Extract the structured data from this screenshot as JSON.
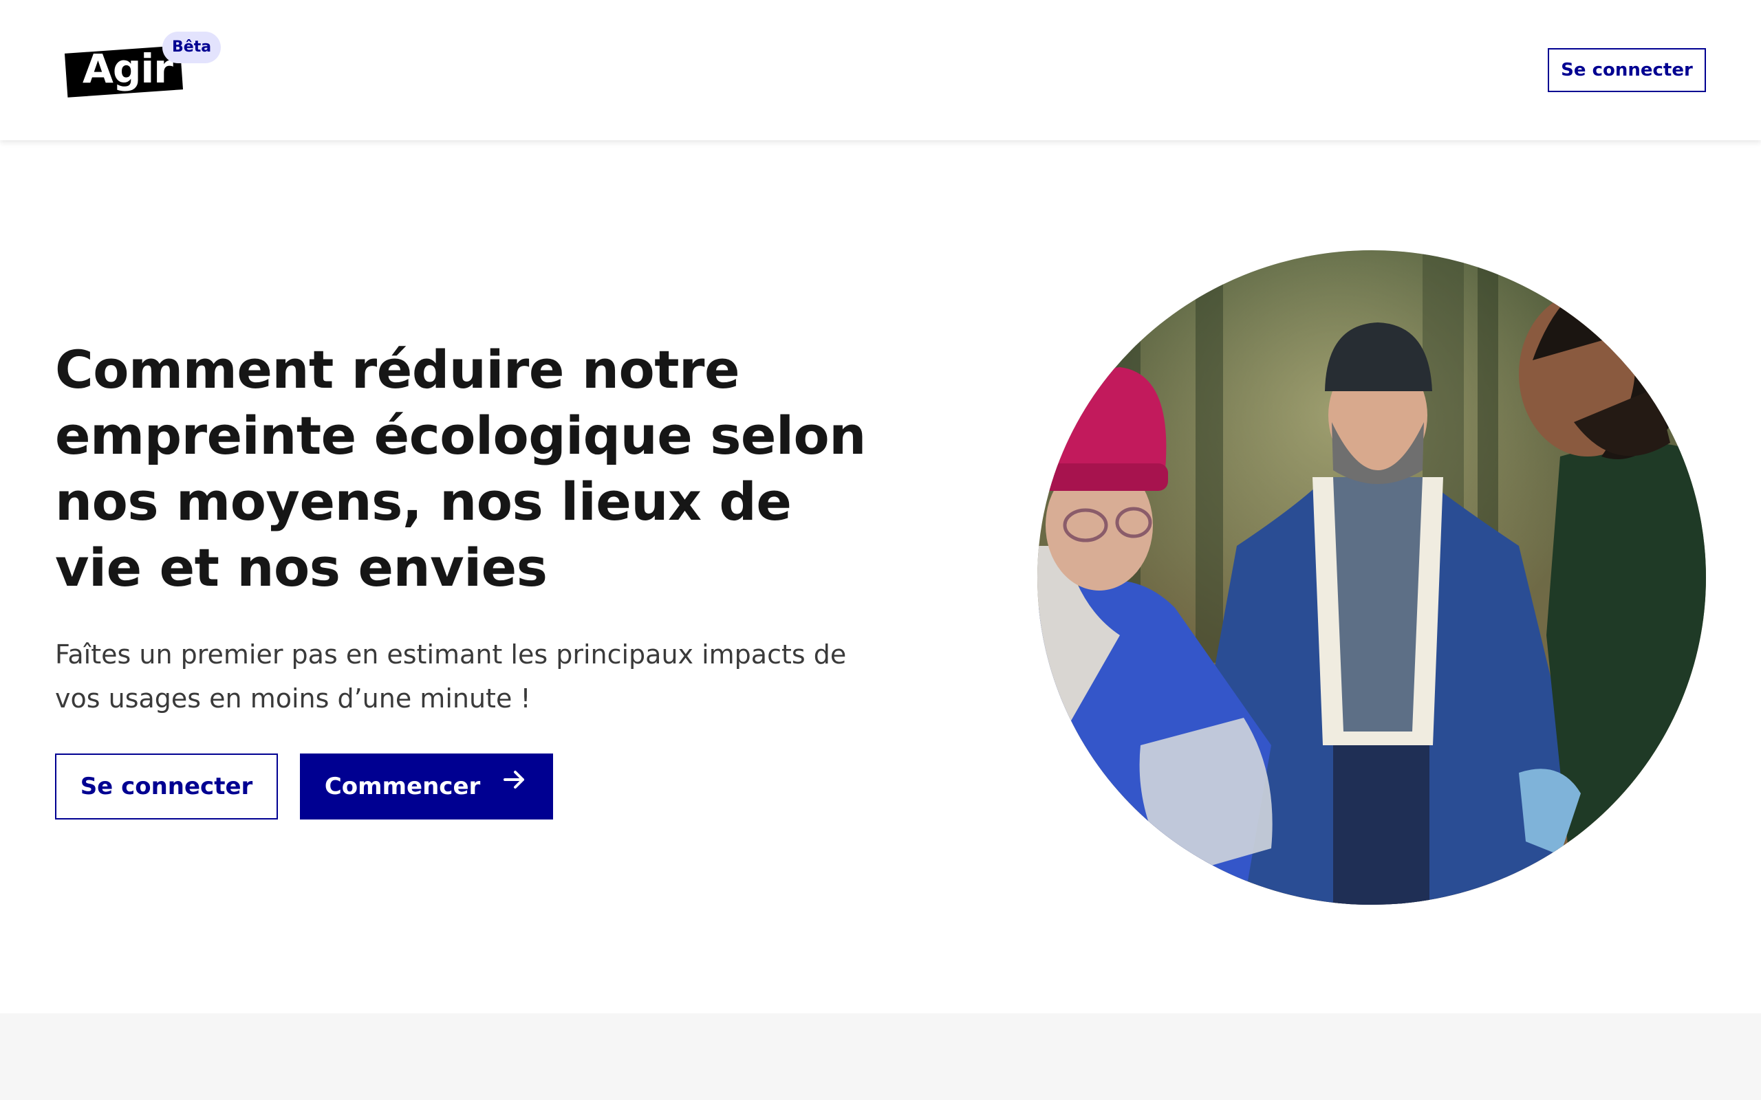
{
  "header": {
    "logo_text": "Agir",
    "beta_label": "Bêta",
    "login_label": "Se connecter"
  },
  "hero": {
    "title": "Comment réduire notre empreinte écologique selon nos moyens, nos lieux de vie et nos envies",
    "subtitle": "Faîtes un premier pas en estimant les principaux impacts de vos usages en moins d’une minute !",
    "secondary_button_label": "Se connecter",
    "primary_button_label": "Commencer",
    "primary_button_icon": "arrow-right-icon",
    "photo_icon": "people-in-forest-photo"
  },
  "colors": {
    "brand_blue": "#000091",
    "beta_badge_bg": "#e3e3fd",
    "text_dark": "#161616",
    "bottom_band": "#f6f6f6"
  }
}
